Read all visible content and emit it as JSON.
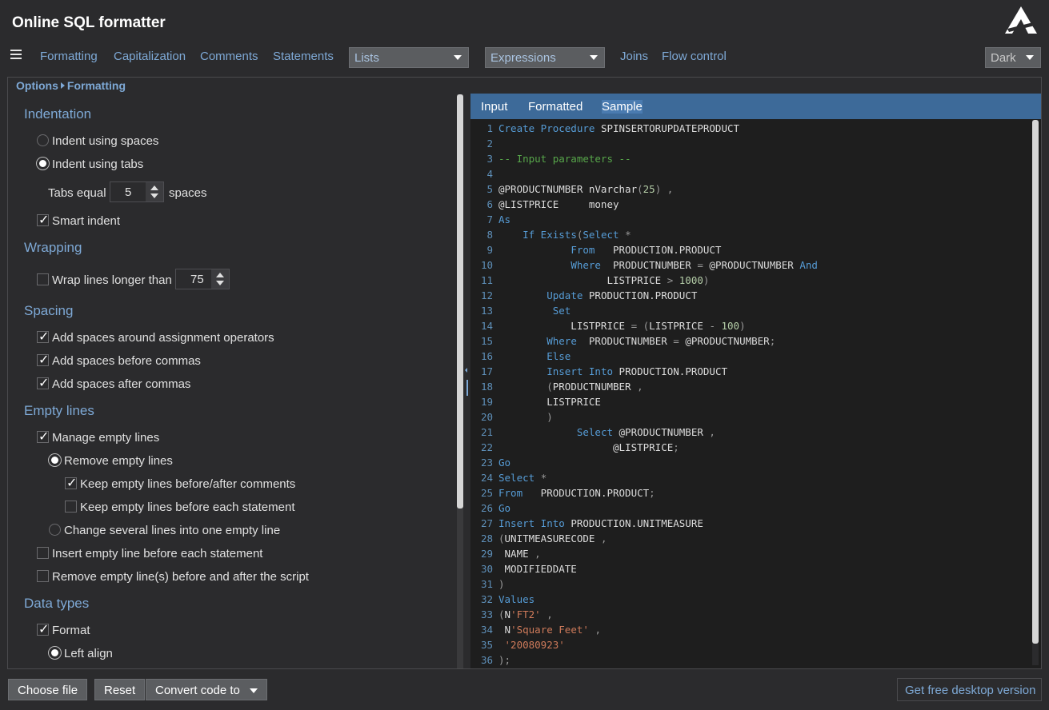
{
  "app": {
    "title": "Online SQL formatter",
    "logo_icon": "triangle-logo-icon"
  },
  "menu": {
    "items": [
      "Formatting",
      "Capitalization",
      "Comments",
      "Statements"
    ],
    "lists_select": "Lists",
    "expressions_select": "Expressions",
    "items2": [
      "Joins",
      "Flow control"
    ],
    "theme_select": "Dark"
  },
  "breadcrumb": {
    "root": "Options",
    "current": "Formatting"
  },
  "options": {
    "indentation": {
      "title": "Indentation",
      "use_spaces": {
        "label": "Indent using spaces",
        "checked": false
      },
      "use_tabs": {
        "label": "Indent using tabs",
        "checked": true
      },
      "tabs_equal_label": "Tabs equal",
      "tabs_value": "5",
      "spaces_label": "spaces",
      "smart_indent": {
        "label": "Smart indent",
        "checked": true
      }
    },
    "wrapping": {
      "title": "Wrapping",
      "wrap_lines": {
        "label": "Wrap lines longer than",
        "checked": false
      },
      "wrap_value": "75"
    },
    "spacing": {
      "title": "Spacing",
      "assign_ops": {
        "label": "Add spaces around assignment operators",
        "checked": true
      },
      "before_commas": {
        "label": "Add spaces before commas",
        "checked": true
      },
      "after_commas": {
        "label": "Add spaces after commas",
        "checked": true
      }
    },
    "empty_lines": {
      "title": "Empty lines",
      "manage": {
        "label": "Manage empty lines",
        "checked": true
      },
      "remove": {
        "label": "Remove empty lines",
        "checked": true
      },
      "keep_comments": {
        "label": "Keep empty lines before/after comments",
        "checked": true
      },
      "keep_statement": {
        "label": "Keep empty lines before each statement",
        "checked": false
      },
      "change_several": {
        "label": "Change several lines into one empty line",
        "checked": false
      },
      "insert_before": {
        "label": "Insert empty line before each statement",
        "checked": false
      },
      "remove_script": {
        "label": "Remove empty line(s) before and after the script",
        "checked": false
      }
    },
    "data_types": {
      "title": "Data types",
      "format": {
        "label": "Format",
        "checked": true
      },
      "left_align": {
        "label": "Left align",
        "checked": true
      }
    }
  },
  "editor": {
    "tabs": [
      "Input",
      "Formatted",
      "Sample"
    ],
    "active_tab": "Sample",
    "lines": [
      {
        "n": "1",
        "html": "<span class='kw'>Create Procedure</span> SPINSERTORUPDATEPRODUCT"
      },
      {
        "n": "2",
        "html": ""
      },
      {
        "n": "3",
        "html": "<span class='cm'>-- Input parameters --</span>"
      },
      {
        "n": "4",
        "html": ""
      },
      {
        "n": "5",
        "html": "@PRODUCTNUMBER nVarchar<span class='op'>(</span><span class='nm'>25</span><span class='op'>) ,</span>"
      },
      {
        "n": "6",
        "html": "@LISTPRICE     money"
      },
      {
        "n": "7",
        "html": "<span class='kw'>As</span>"
      },
      {
        "n": "8",
        "html": "    <span class='kw'>If Exists</span><span class='op'>(</span><span class='kw'>Select</span> <span class='op'>*</span>"
      },
      {
        "n": "9",
        "html": "            <span class='kw'>From</span>   PRODUCTION.PRODUCT"
      },
      {
        "n": "10",
        "html": "            <span class='kw'>Where</span>  PRODUCTNUMBER <span class='op'>=</span> @PRODUCTNUMBER <span class='kw'>And</span>"
      },
      {
        "n": "11",
        "html": "                  LISTPRICE <span class='op'>&gt;</span> <span class='nm'>1000</span><span class='op'>)</span>"
      },
      {
        "n": "12",
        "html": "        <span class='kw'>Update</span> PRODUCTION.PRODUCT"
      },
      {
        "n": "13",
        "html": "         <span class='kw'>Set</span>"
      },
      {
        "n": "14",
        "html": "            LISTPRICE <span class='op'>=</span> <span class='op'>(</span>LISTPRICE <span class='op'>-</span> <span class='nm'>100</span><span class='op'>)</span>"
      },
      {
        "n": "15",
        "html": "        <span class='kw'>Where</span>  PRODUCTNUMBER <span class='op'>=</span> @PRODUCTNUMBER<span class='op'>;</span>"
      },
      {
        "n": "16",
        "html": "        <span class='kw'>Else</span>"
      },
      {
        "n": "17",
        "html": "        <span class='kw'>Insert Into</span> PRODUCTION.PRODUCT"
      },
      {
        "n": "18",
        "html": "        <span class='op'>(</span>PRODUCTNUMBER <span class='op'>,</span>"
      },
      {
        "n": "19",
        "html": "        LISTPRICE"
      },
      {
        "n": "20",
        "html": "        <span class='op'>)</span>"
      },
      {
        "n": "21",
        "html": "             <span class='kw'>Select</span> @PRODUCTNUMBER <span class='op'>,</span>"
      },
      {
        "n": "22",
        "html": "                   @LISTPRICE<span class='op'>;</span>"
      },
      {
        "n": "23",
        "html": "<span class='kw'>Go</span>"
      },
      {
        "n": "24",
        "html": "<span class='kw'>Select</span> <span class='op'>*</span>"
      },
      {
        "n": "25",
        "html": "<span class='kw'>From</span>   PRODUCTION.PRODUCT<span class='op'>;</span>"
      },
      {
        "n": "26",
        "html": "<span class='kw'>Go</span>"
      },
      {
        "n": "27",
        "html": "<span class='kw'>Insert Into</span> PRODUCTION.UNITMEASURE"
      },
      {
        "n": "28",
        "html": "<span class='op'>(</span>UNITMEASURECODE <span class='op'>,</span>"
      },
      {
        "n": "29",
        "html": " NAME <span class='op'>,</span>"
      },
      {
        "n": "30",
        "html": " MODIFIEDDATE"
      },
      {
        "n": "31",
        "html": "<span class='op'>)</span>"
      },
      {
        "n": "32",
        "html": "<span class='kw'>Values</span>"
      },
      {
        "n": "33",
        "html": "<span class='op'>(</span>N<span class='st'>'FT2'</span> <span class='op'>,</span>"
      },
      {
        "n": "34",
        "html": " N<span class='st'>'Square Feet'</span> <span class='op'>,</span>"
      },
      {
        "n": "35",
        "html": " <span class='st'>'20080923'</span>"
      },
      {
        "n": "36",
        "html": "<span class='op'>);</span>"
      }
    ]
  },
  "footer": {
    "choose_file": "Choose file",
    "reset": "Reset",
    "convert": "Convert code to",
    "desktop": "Get free desktop version"
  }
}
